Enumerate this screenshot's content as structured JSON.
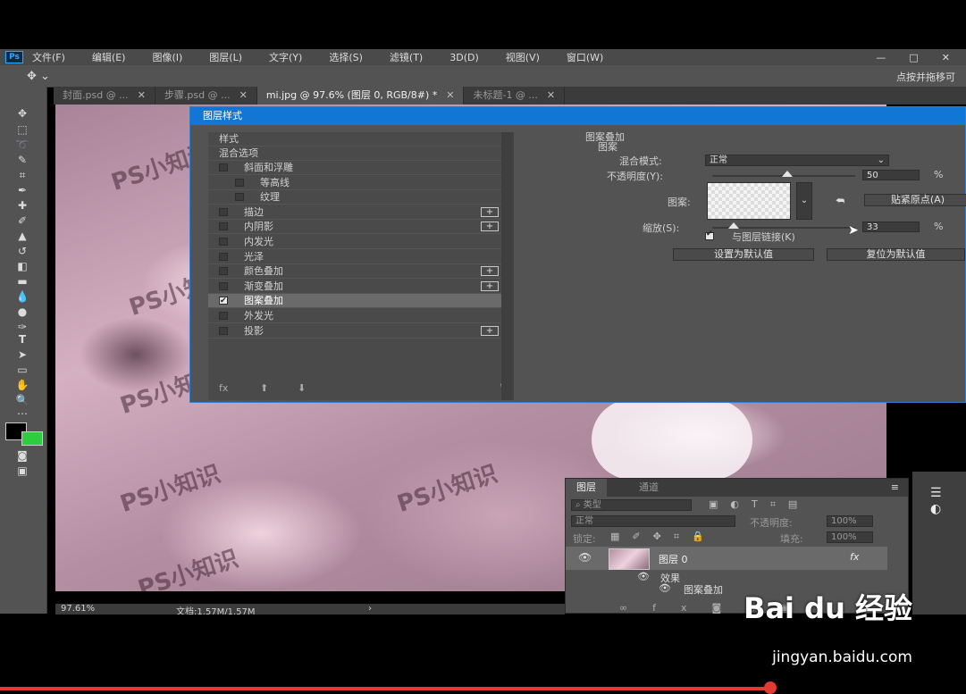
{
  "app": {
    "logo": "Ps"
  },
  "menu": [
    "文件(F)",
    "编辑(E)",
    "图像(I)",
    "图层(L)",
    "文字(Y)",
    "选择(S)",
    "滤镜(T)",
    "3D(D)",
    "视图(V)",
    "窗口(W)"
  ],
  "window_controls": [
    "—",
    "□",
    "✕"
  ],
  "options_bar": {
    "hint": "点按并拖移可"
  },
  "tabs": [
    {
      "label": "封面.psd @ ..."
    },
    {
      "label": "步骤.psd @ ..."
    },
    {
      "label": "mi.jpg @ 97.6% (图层 0, RGB/8#) *"
    },
    {
      "label": "未标题-1 @ ..."
    }
  ],
  "status": {
    "zoom": "97.61%",
    "doc": "文档:1.57M/1.57M"
  },
  "watermark": "PS小知识",
  "dialog": {
    "title": "图层样式",
    "styles_header": "样式",
    "blend_options": "混合选项",
    "items": [
      {
        "label": "斜面和浮雕",
        "checked": false,
        "plus": false,
        "indent": false
      },
      {
        "label": "等高线",
        "checked": false,
        "plus": false,
        "indent": true
      },
      {
        "label": "纹理",
        "checked": false,
        "plus": false,
        "indent": true
      },
      {
        "label": "描边",
        "checked": false,
        "plus": true,
        "indent": false
      },
      {
        "label": "内阴影",
        "checked": false,
        "plus": true,
        "indent": false
      },
      {
        "label": "内发光",
        "checked": false,
        "plus": false,
        "indent": false
      },
      {
        "label": "光泽",
        "checked": false,
        "plus": false,
        "indent": false
      },
      {
        "label": "颜色叠加",
        "checked": false,
        "plus": true,
        "indent": false
      },
      {
        "label": "渐变叠加",
        "checked": false,
        "plus": true,
        "indent": false
      },
      {
        "label": "图案叠加",
        "checked": true,
        "plus": false,
        "indent": false,
        "selected": true
      },
      {
        "label": "外发光",
        "checked": false,
        "plus": false,
        "indent": false
      },
      {
        "label": "投影",
        "checked": false,
        "plus": true,
        "indent": false
      }
    ],
    "plus_sign": "+",
    "footer": {
      "fx": "fx",
      "up": "⬆",
      "down": "⬇",
      "trash": "🗑"
    },
    "section_title": "图案叠加",
    "section_sub": "图案",
    "blend_mode_label": "混合模式:",
    "blend_mode_value": "正常",
    "opacity_label": "不透明度(Y):",
    "opacity_value": "50",
    "opacity_unit": "%",
    "pattern_label": "图案:",
    "snap_button": "贴紧原点(A)",
    "scale_label": "缩放(S):",
    "scale_value": "33",
    "scale_unit": "%",
    "link_label": "与图层链接(K)",
    "link_checked": true,
    "default_button": "设置为默认值",
    "reset_button": "复位为默认值"
  },
  "layers_panel": {
    "tabs": [
      "图层",
      "通道"
    ],
    "filter_label": "类型",
    "blend_mode": "正常",
    "opacity_label": "不透明度:",
    "opacity_value": "100%",
    "lock_label": "锁定:",
    "fill_label": "填充:",
    "fill_value": "100%",
    "layer_name": "图层 0",
    "fx_label": "fx",
    "effects_label": "效果",
    "effect_item": "图案叠加"
  },
  "overlay": {
    "brand": "Bai du 经验",
    "url": "jingyan.baidu.com"
  },
  "colors": {
    "accent": "#1277d4",
    "fg_swatch": "#000000",
    "bg_swatch": "#2ecc40",
    "progress": "#e53935"
  }
}
